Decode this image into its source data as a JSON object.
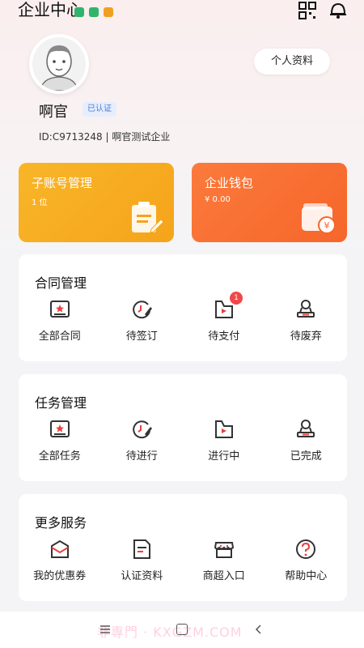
{
  "status": {
    "title": "企业中心"
  },
  "profile": {
    "edit_label": "个人资料",
    "name": "啊官",
    "verified": "已认证",
    "id_line": "ID:C9713248 | 啊官测试企业"
  },
  "cards": [
    {
      "title": "子账号管理",
      "value": "1 位",
      "color": "#f8b528"
    },
    {
      "title": "企业钱包",
      "value": "¥ 0.00",
      "color": "#fb7a3c"
    }
  ],
  "contract": {
    "title": "合同管理",
    "items": [
      {
        "label": "全部合同",
        "icon": "contract-all-icon"
      },
      {
        "label": "待签订",
        "icon": "sign-pending-icon"
      },
      {
        "label": "待支付",
        "icon": "pay-pending-icon",
        "badge": "1"
      },
      {
        "label": "待废弃",
        "icon": "discard-pending-icon"
      }
    ]
  },
  "task": {
    "title": "任务管理",
    "items": [
      {
        "label": "全部任务",
        "icon": "task-all-icon"
      },
      {
        "label": "待进行",
        "icon": "task-pending-icon"
      },
      {
        "label": "进行中",
        "icon": "task-progress-icon"
      },
      {
        "label": "已完成",
        "icon": "task-done-icon"
      }
    ]
  },
  "services": {
    "title": "更多服务",
    "items": [
      {
        "label": "我的优惠券",
        "icon": "coupon-icon"
      },
      {
        "label": "认证资料",
        "icon": "certificate-icon"
      },
      {
        "label": "商超入口",
        "icon": "store-icon"
      },
      {
        "label": "帮助中心",
        "icon": "help-icon"
      }
    ]
  },
  "watermark": " 非專門 · KXGZM.COM",
  "colors": {
    "accent": "#3a3a3a",
    "icon_red": "#e84040",
    "badge": "#f04848"
  }
}
